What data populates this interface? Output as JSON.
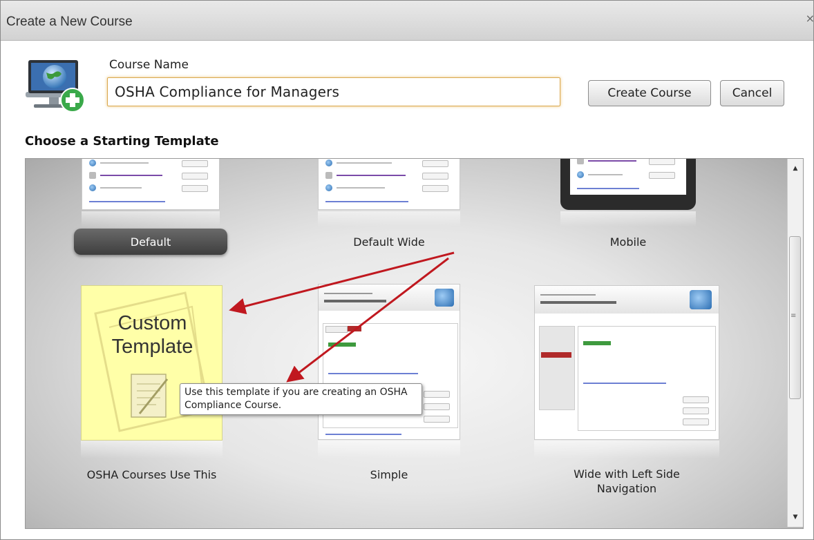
{
  "dialog": {
    "title": "Create a New Course",
    "close_glyph": "×"
  },
  "form": {
    "course_name_label": "Course Name",
    "course_name_value": "OSHA Compliance for Managers",
    "create_button": "Create Course",
    "cancel_button": "Cancel"
  },
  "templates_section": {
    "title": "Choose a Starting Template",
    "templates": [
      {
        "label": "Default",
        "selected": true
      },
      {
        "label": "Default Wide",
        "selected": false
      },
      {
        "label": "Mobile",
        "selected": false
      },
      {
        "label": "OSHA Courses Use This",
        "thumb_text": "Custom Template",
        "selected": false
      },
      {
        "label": "Simple",
        "selected": false
      },
      {
        "label": "Wide with Left Side Navigation",
        "selected": false
      }
    ],
    "tooltip": "Use this template if you are creating an OSHA Compliance Course."
  },
  "scrollbar": {
    "up_glyph": "▲",
    "down_glyph": "▼",
    "grip_glyph": "≡"
  },
  "colors": {
    "annotation_arrow": "#c0181f",
    "custom_template_bg": "#ffffa8",
    "input_focus": "#e6aa3c"
  }
}
